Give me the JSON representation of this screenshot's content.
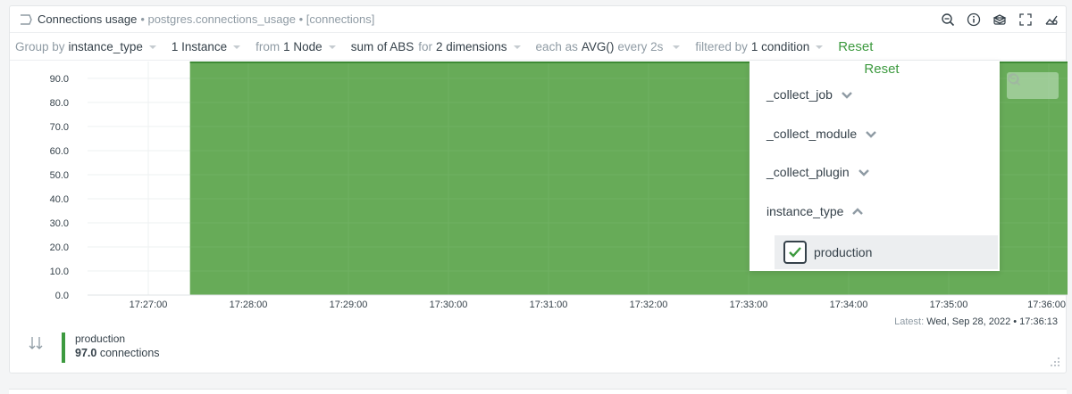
{
  "header": {
    "title": "Connections usage",
    "context": "• postgres.connections_usage • [connections]",
    "actions": [
      "zoom-icon",
      "info-icon",
      "layers-icon",
      "fullscreen-icon",
      "chart-type-icon"
    ]
  },
  "toolbar": {
    "group_by_label": "Group by",
    "group_by_value": "instance_type",
    "instances": "1 Instance",
    "from_label": "from",
    "nodes": "1 Node",
    "aggregation": "sum of ABS",
    "for_label": "for",
    "dimensions": "2 dimensions",
    "each_label": "each as",
    "each_value": "AVG()",
    "every_label": "every 2s",
    "filtered_label": "filtered by",
    "filtered_value": "1 condition",
    "reset": "Reset"
  },
  "dropdown": {
    "reset": "Reset",
    "items": [
      {
        "label": "_collect_job",
        "expanded": false
      },
      {
        "label": "_collect_module",
        "expanded": false
      },
      {
        "label": "_collect_plugin",
        "expanded": false
      },
      {
        "label": "instance_type",
        "expanded": true
      }
    ],
    "selected_option": {
      "label": "production",
      "checked": true
    }
  },
  "chart_data": {
    "type": "area",
    "title": "Connections usage",
    "xlabel": "",
    "ylabel": "",
    "y_ticks": [
      "90.0",
      "80.0",
      "70.0",
      "60.0",
      "50.0",
      "40.0",
      "30.0",
      "20.0",
      "10.0",
      "0.0"
    ],
    "x_ticks": [
      "17:27:00",
      "17:28:00",
      "17:29:00",
      "17:30:00",
      "17:31:00",
      "17:32:00",
      "17:33:00",
      "17:34:00",
      "17:35:00",
      "17:36:00"
    ],
    "ylim": [
      0,
      97
    ],
    "grid": true,
    "series": [
      {
        "name": "production",
        "color": "#5fa64f",
        "start": "17:27:25",
        "end": "17:36:13",
        "value": 97.0
      }
    ]
  },
  "footer": {
    "latest_label": "Latest:",
    "latest_value": "Wed, Sep 28, 2022 • 17:36:13",
    "legend_name": "production",
    "legend_value": "97.0",
    "legend_unit": "connections"
  },
  "colors": {
    "accent": "#3d9a3f",
    "series": "#5fa64f",
    "muted": "#8f9ba4",
    "text": "#35414a"
  }
}
